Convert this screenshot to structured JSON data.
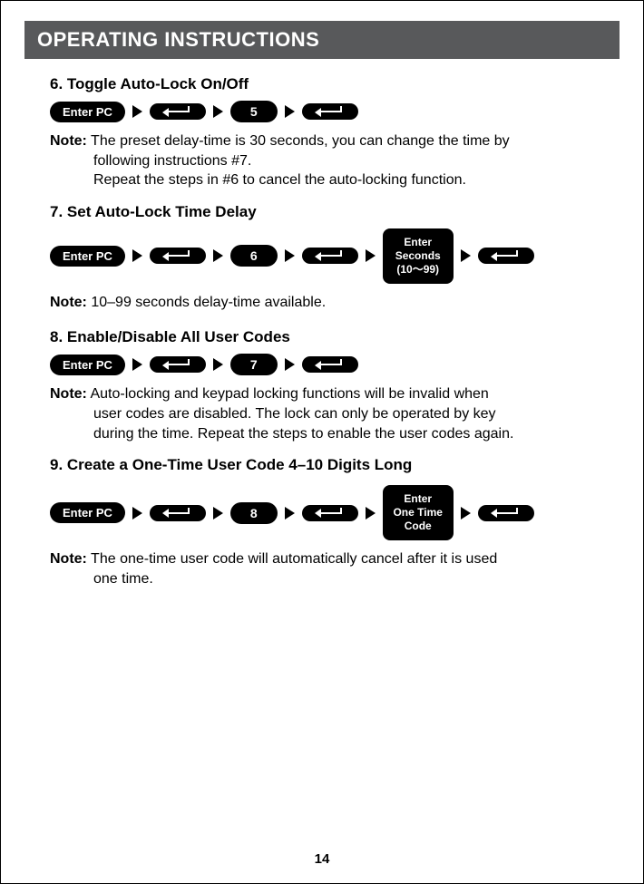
{
  "header": {
    "title": "OPERATING INSTRUCTIONS"
  },
  "sections": {
    "s6": {
      "title": "6. Toggle Auto-Lock On/Off",
      "enter_pc": "Enter PC",
      "digit": "5",
      "note_label": "Note:",
      "note_line1": "The preset delay-time is 30 seconds, you can change the time by",
      "note_line2": "following instructions #7.",
      "note_line3": "Repeat the steps in #6 to cancel the auto-locking function."
    },
    "s7": {
      "title": "7. Set Auto-Lock Time Delay",
      "enter_pc": "Enter PC",
      "digit": "6",
      "box_l1": "Enter",
      "box_l2": "Seconds",
      "box_l3": "(10～99)",
      "note_label": "Note:",
      "note_text": "10–99 seconds delay-time available."
    },
    "s8": {
      "title": "8. Enable/Disable All User Codes",
      "enter_pc": "Enter PC",
      "digit": "7",
      "note_label": "Note:",
      "note_line1": "Auto-locking and keypad locking functions will be invalid when",
      "note_line2": "user codes are disabled. The lock can only be operated by key",
      "note_line3": "during the time. Repeat the steps to enable the user codes again."
    },
    "s9": {
      "title": "9. Create a One-Time User Code 4–10 Digits Long",
      "enter_pc": "Enter PC",
      "digit": "8",
      "box_l1": "Enter",
      "box_l2": "One Time",
      "box_l3": "Code",
      "note_label": "Note:",
      "note_line1": "The one-time user code will automatically cancel after it is used",
      "note_line2": "one time."
    }
  },
  "page_number": "14"
}
